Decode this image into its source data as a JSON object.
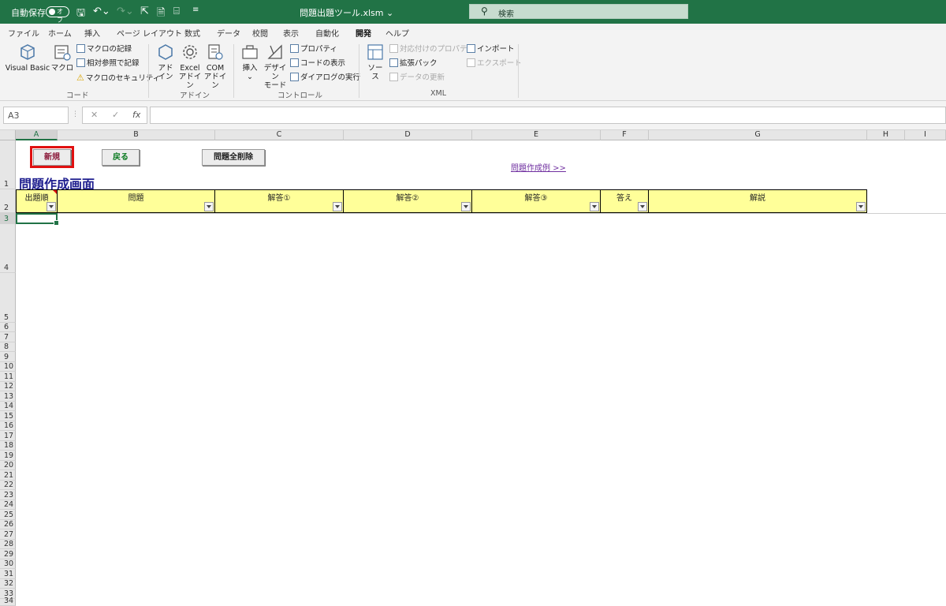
{
  "titlebar": {
    "autosave_label": "自動保存",
    "autosave_state": "オフ",
    "filename": "問題出題ツール.xlsm ⌄",
    "search_placeholder": "検索"
  },
  "tabs": [
    "ファイル",
    "ホーム",
    "挿入",
    "ページ レイアウト",
    "数式",
    "データ",
    "校閲",
    "表示",
    "自動化",
    "開発",
    "ヘルプ"
  ],
  "active_tab": "開発",
  "ribbon": {
    "code": {
      "label": "コード",
      "visual_basic": "Visual Basic",
      "macro": "マクロ",
      "record_macro": "マクロの記録",
      "relative_ref": "相対参照で記録",
      "macro_security": "マクロのセキュリティ"
    },
    "addins": {
      "label": "アドイン",
      "addin_1": "アド",
      "addin_2": "イン",
      "excel_1": "Excel",
      "excel_2": "アドイン",
      "com_1": "COM",
      "com_2": "アドイン"
    },
    "controls": {
      "label": "コントロール",
      "insert": "挿入",
      "design_1": "デザイン",
      "design_2": "モード",
      "properties": "プロパティ",
      "view_code": "コードの表示",
      "run_dialog": "ダイアログの実行"
    },
    "xml": {
      "label": "XML",
      "source": "ソース",
      "map_props": "対応付けのプロパティ",
      "expansion": "拡張パック",
      "refresh": "データの更新",
      "import": "インポート",
      "export": "エクスポート"
    }
  },
  "formula_bar": {
    "namebox": "A3",
    "cancel": "✕",
    "enter": "✓",
    "fx": "fx"
  },
  "columns": [
    "A",
    "B",
    "C",
    "D",
    "E",
    "F",
    "G",
    "H",
    "I"
  ],
  "rows": [
    "1",
    "2",
    "3",
    "4",
    "5",
    "6",
    "7",
    "8",
    "9",
    "10",
    "11",
    "12",
    "13",
    "14",
    "15",
    "16",
    "17",
    "18",
    "19",
    "20",
    "21",
    "22",
    "23",
    "24",
    "25",
    "26",
    "27",
    "28",
    "29",
    "30",
    "31",
    "32",
    "33",
    "34"
  ],
  "sheet": {
    "new_button": "新規",
    "back_button": "戻る",
    "delete_all_button": "問題全削除",
    "example_link": "問題作成例 >>",
    "title": "問題作成画面",
    "headers": [
      "出題順",
      "問題",
      "解答①",
      "解答②",
      "解答③",
      "答え",
      "解説"
    ]
  },
  "colors": {
    "excel_green": "#217346",
    "header_fill": "#ffff99",
    "title_blue": "#1f1f8f",
    "highlight_red": "#e01010"
  }
}
